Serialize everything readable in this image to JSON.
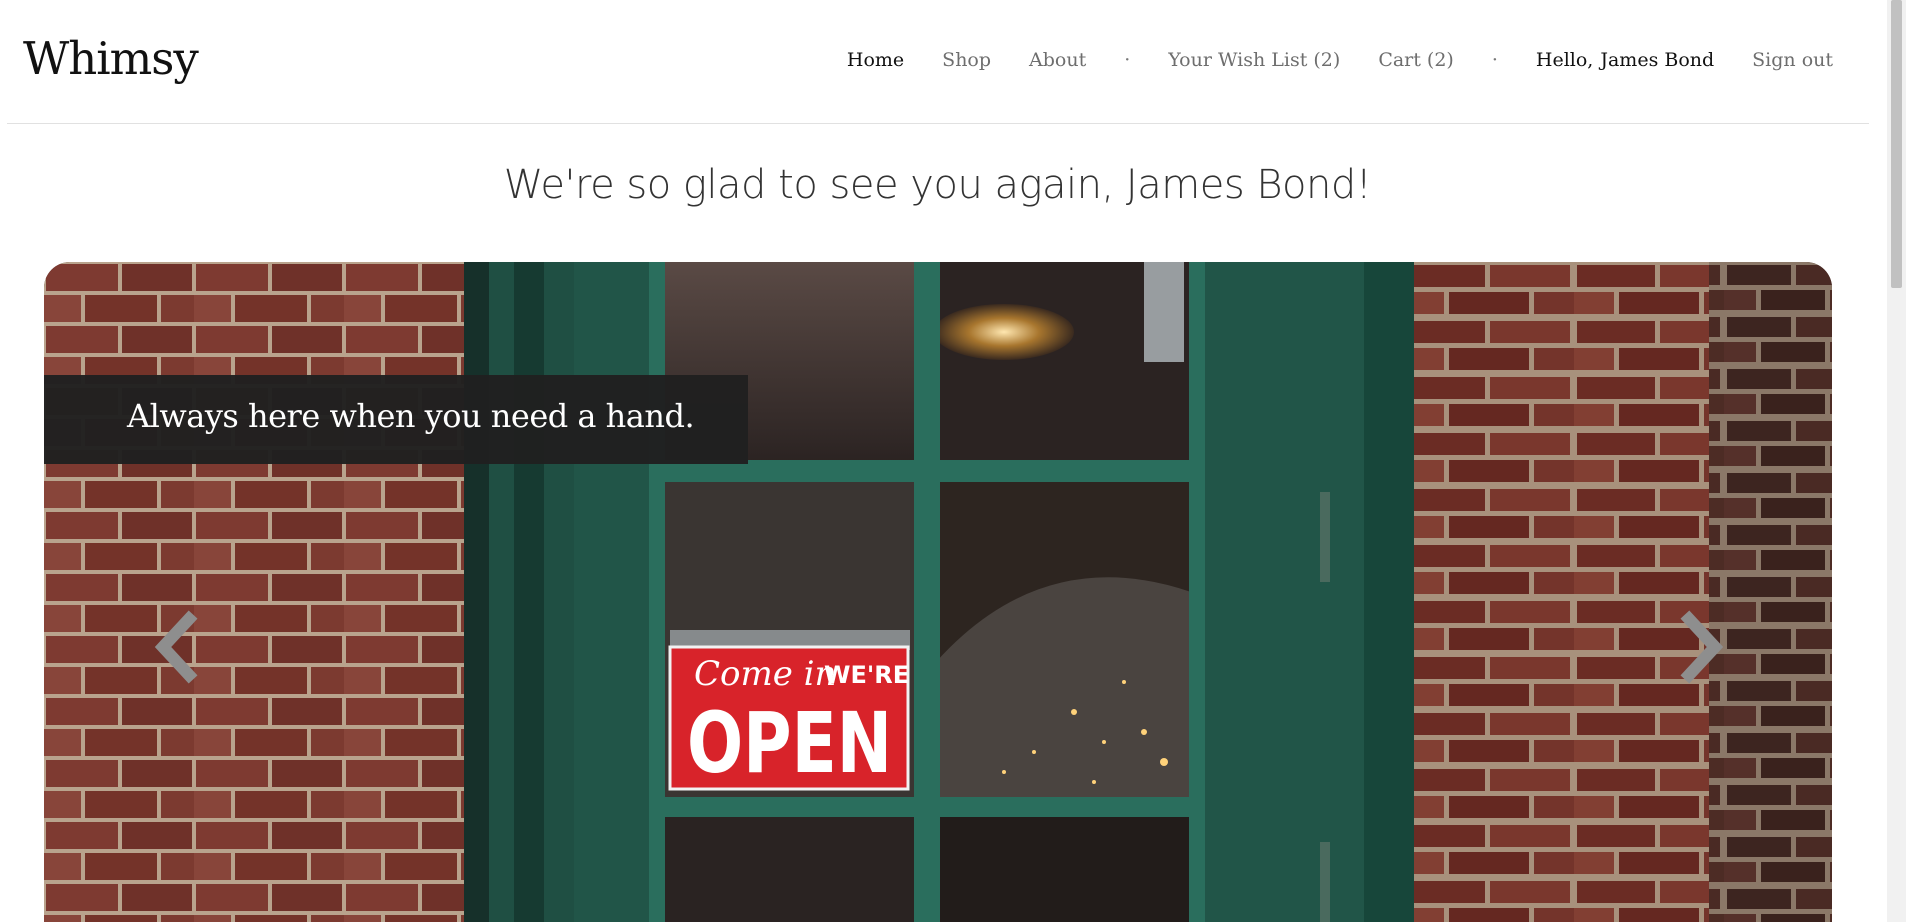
{
  "header": {
    "logo": "Whimsy",
    "nav": {
      "home": "Home",
      "shop": "Shop",
      "about": "About",
      "separator": "·",
      "wishlist": "Your Wish List (2)",
      "cart": "Cart (2)",
      "greeting": "Hello,",
      "user_name": "James Bond",
      "signout": "Sign out"
    }
  },
  "main": {
    "welcome": "We're so glad to see you again, James Bond!",
    "hero": {
      "caption": "Always here when you need a hand.",
      "sign_line1": "Come in",
      "sign_line1b": "WE'RE",
      "sign_line2": "OPEN",
      "prev_icon": "chevron-left-icon",
      "next_icon": "chevron-right-icon"
    }
  },
  "colors": {
    "brick": "#7d3a30",
    "door_green": "#1e4d41",
    "sign_red": "#d8232a",
    "caption_bg": "#202020"
  }
}
